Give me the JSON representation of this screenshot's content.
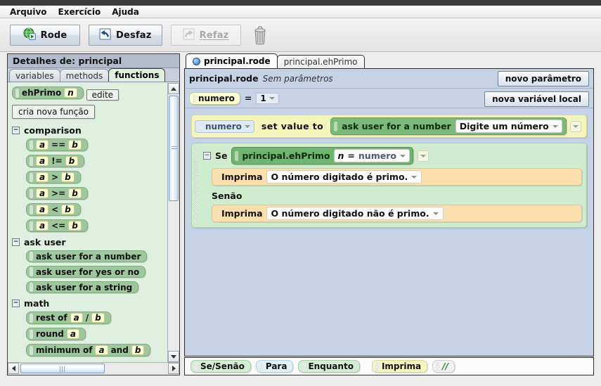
{
  "menu": {
    "items": [
      {
        "label": "Arquivo",
        "name": "menu-arquivo"
      },
      {
        "label": "Exercício",
        "name": "menu-exercicio"
      },
      {
        "label": "Ajuda",
        "name": "menu-ajuda"
      }
    ]
  },
  "toolbar": {
    "run_label": "Rode",
    "run_icon": "globe-play-icon",
    "undo_label": "Desfaz",
    "undo_icon": "undo-arrow-icon",
    "redo_label": "Refaz",
    "redo_icon": "redo-arrow-icon",
    "redo_disabled": true,
    "trash_icon": "trash-can-icon"
  },
  "left_panel": {
    "title": "Detalhes de: principal",
    "tabs": [
      {
        "label": "variables",
        "active": false
      },
      {
        "label": "methods",
        "active": false
      },
      {
        "label": "functions",
        "active": true
      }
    ],
    "function_tile": {
      "name": "ehPrimo",
      "param": "n"
    },
    "edit_button": "edite",
    "new_function_button": "cria nova função",
    "groups": [
      {
        "name": "comparison",
        "expanded": true,
        "toggle_glyph": "−",
        "items": [
          {
            "a": "a",
            "op": "==",
            "b": "b"
          },
          {
            "a": "a",
            "op": "!=",
            "b": "b"
          },
          {
            "a": "a",
            "op": ">",
            "b": "b"
          },
          {
            "a": "a",
            "op": ">=",
            "b": "b"
          },
          {
            "a": "a",
            "op": "<",
            "b": "b"
          },
          {
            "a": "a",
            "op": "<=",
            "b": "b"
          }
        ]
      },
      {
        "name": "ask user",
        "expanded": true,
        "toggle_glyph": "−",
        "plain_items": [
          "ask user for a number",
          "ask user for yes or no",
          "ask user for a string"
        ]
      },
      {
        "name": "math",
        "expanded": true,
        "toggle_glyph": "−",
        "math_items": [
          {
            "pre": "rest of",
            "a": "a",
            "mid": "/",
            "b": "b"
          },
          {
            "pre": "round",
            "a": "a",
            "mid": "",
            "b": ""
          },
          {
            "pre": "minimum of",
            "a": "a",
            "mid": "and",
            "b": "b"
          }
        ]
      }
    ]
  },
  "editor": {
    "tabs": [
      {
        "label": "principal.rode",
        "active": true,
        "icon": "blue-sphere-icon"
      },
      {
        "label": "principal.ehPrimo",
        "active": false,
        "icon": ""
      }
    ],
    "header": {
      "name": "principal.rode",
      "params": "Sem parâmetros"
    },
    "new_param_button": "novo parâmetro",
    "new_local_var_button": "nova variável local",
    "local_var": {
      "name": "numero",
      "equals": "=",
      "value": "1"
    },
    "code": {
      "assign": {
        "target": "numero",
        "keyword": "set value to",
        "call": "ask user for a number",
        "arg": "Digite um número"
      },
      "if": {
        "keyword": "Se",
        "condition_fn": "principal.ehPrimo",
        "condition_param": "n",
        "condition_eq": "=",
        "condition_val": "numero",
        "then": {
          "keyword": "Imprima",
          "value": "O número digitado é primo."
        },
        "else_keyword": "Senão",
        "else": {
          "keyword": "Imprima",
          "value": "O número digitado não é primo."
        }
      }
    }
  },
  "palette": {
    "items": [
      {
        "label": "Se/Senão",
        "style": "p-green"
      },
      {
        "label": "Para",
        "style": "p-blue"
      },
      {
        "label": "Enquanto",
        "style": "p-green"
      },
      {
        "label": "Imprima",
        "style": "p-yellow"
      },
      {
        "label": "//",
        "style": "p-comment"
      }
    ]
  },
  "colors": {
    "accent_green": "#7bba7b",
    "panel_blue": "#c6d2e6",
    "tile_green": "#9ec79e",
    "yellow_slot": "#fbfbd4",
    "print_orange": "#fbe0ae"
  }
}
